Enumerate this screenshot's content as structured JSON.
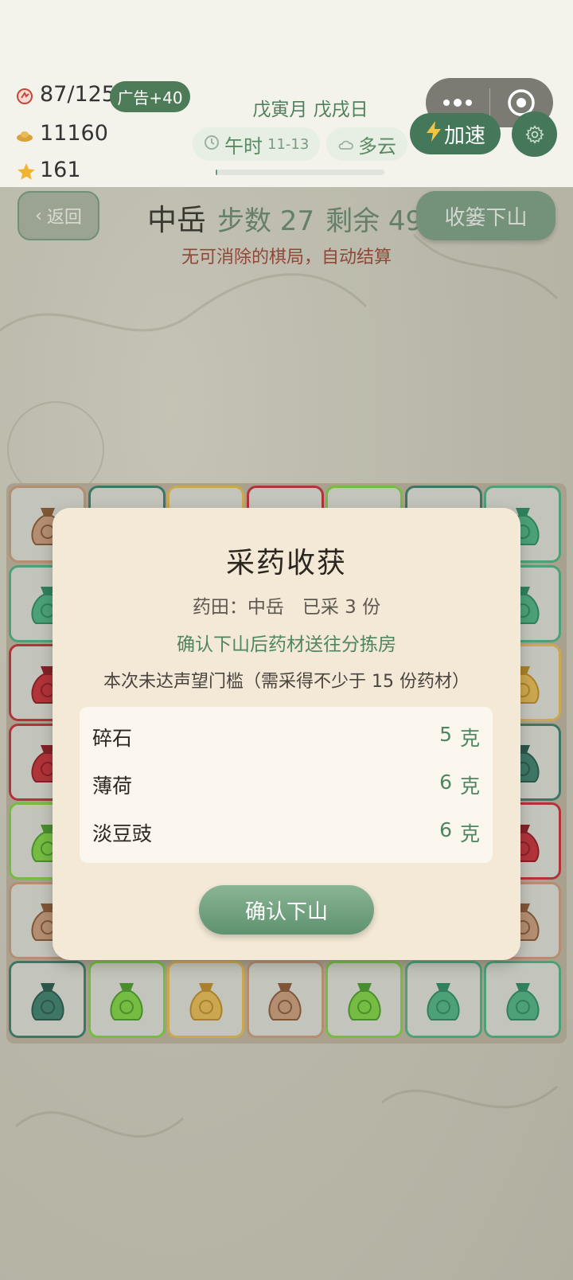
{
  "resources": {
    "stamina": "87/125",
    "ad_bonus": "广告+40",
    "coins": "11160",
    "stars": "161"
  },
  "calendar": {
    "date": "戊寅月 戊戌日",
    "time_label": "午时",
    "time_range": "11-13",
    "weather": "多云",
    "day_progress": 0.01
  },
  "controls": {
    "speed_label": "加速",
    "back_label": "返回",
    "collect_label": "收篓下山"
  },
  "level": {
    "name": "中岳",
    "steps_label": "步数 27",
    "remaining_label": "剩余 49"
  },
  "notice": "无可消除的棋局，自动结算",
  "modal": {
    "title": "采药收获",
    "field_summary": "药田：中岳　已采 3 份",
    "delivery_note": "确认下山后药材送往分拣房",
    "threshold_note": "本次未达声望门槛（需采得不少于 15 份药材）",
    "herbs": [
      {
        "name": "碎石",
        "amount": "5",
        "unit": "克"
      },
      {
        "name": "薄荷",
        "amount": "6",
        "unit": "克"
      },
      {
        "name": "淡豆豉",
        "amount": "6",
        "unit": "克"
      }
    ],
    "confirm_label": "确认下山"
  },
  "colors": {
    "accent_green": "#45775a",
    "warning_red": "#9b4a3a",
    "modal_bg": "#f3e9d6"
  },
  "board_tiles": [
    [
      "brown-pouch",
      "teal-pouch",
      "gold-pouch",
      "red-pouch",
      "lime-pouch",
      "teal-pouch",
      "green-pouch"
    ],
    [
      "green-pouch",
      "",
      "",
      "",
      "",
      "",
      "green-pouch"
    ],
    [
      "red-pouch",
      "",
      "",
      "",
      "",
      "",
      "gold-pouch"
    ],
    [
      "red-pouch",
      "",
      "",
      "",
      "",
      "",
      "teal-pouch"
    ],
    [
      "lime-pouch",
      "",
      "",
      "",
      "",
      "",
      "red-pouch"
    ],
    [
      "brown-pouch",
      "",
      "",
      "",
      "",
      "",
      "brown-pouch"
    ],
    [
      "teal-pouch",
      "lime-pouch",
      "gold-pouch",
      "brown-pouch",
      "lime-pouch",
      "green-pouch",
      "green-pouch"
    ]
  ]
}
